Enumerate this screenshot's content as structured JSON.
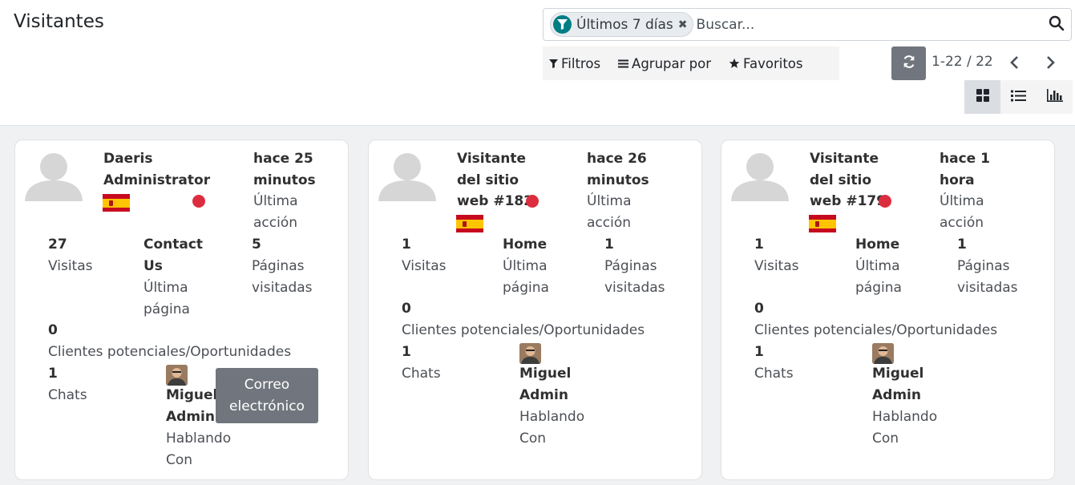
{
  "header": {
    "title": "Visitantes",
    "search": {
      "facet_label": "Últimos 7 días",
      "placeholder": "Buscar..."
    },
    "filters_label": "Filtros",
    "group_by_label": "Agrupar por",
    "favorites_label": "Favoritos",
    "pager": "1-22 / 22"
  },
  "cards": [
    {
      "name_line1": "Daeris",
      "name_line2": "Administrator",
      "last_action_time": "hace 25 minutos",
      "time_line1": "hace 25",
      "time_line2": "minutos",
      "last_action_label_1": "Última",
      "last_action_label_2": "acción",
      "visits_count": "27",
      "visits_label": "Visitas",
      "last_page_line1": "Contact",
      "last_page_line2": "Us",
      "last_page_label_1": "Última",
      "last_page_label_2": "página",
      "pages_count": "5",
      "pages_label_1": "Páginas",
      "pages_label_2": "visitadas",
      "leads_count": "0",
      "leads_label": "Clientes potenciales/Oportunidades",
      "chats_count": "1",
      "chats_label": "Chats",
      "operator_line1": "Miguel",
      "operator_line2": "Admin",
      "speaking_line1": "Hablando",
      "speaking_line2": "Con",
      "email_line1": "Correo",
      "email_line2": "electrónico"
    },
    {
      "name_line1": "Visitante",
      "name_line2": "del sitio",
      "name_line3": "web #182",
      "time_line1": "hace 26",
      "time_line2": "minutos",
      "last_action_label_1": "Última",
      "last_action_label_2": "acción",
      "visits_count": "1",
      "visits_label": "Visitas",
      "last_page": "Home",
      "last_page_label_1": "Última",
      "last_page_label_2": "página",
      "pages_count": "1",
      "pages_label_1": "Páginas",
      "pages_label_2": "visitadas",
      "leads_count": "0",
      "leads_label": "Clientes potenciales/Oportunidades",
      "chats_count": "1",
      "chats_label": "Chats",
      "operator_line1": "Miguel",
      "operator_line2": "Admin",
      "speaking_line1": "Hablando",
      "speaking_line2": "Con"
    },
    {
      "name_line1": "Visitante",
      "name_line2": "del sitio",
      "name_line3": "web #179",
      "time_line1": "hace 1",
      "time_line2": "hora",
      "last_action_label_1": "Última",
      "last_action_label_2": "acción",
      "visits_count": "1",
      "visits_label": "Visitas",
      "last_page": "Home",
      "last_page_label_1": "Última",
      "last_page_label_2": "página",
      "pages_count": "1",
      "pages_label_1": "Páginas",
      "pages_label_2": "visitadas",
      "leads_count": "0",
      "leads_label": "Clientes potenciales/Oportunidades",
      "chats_count": "1",
      "chats_label": "Chats",
      "operator_line1": "Miguel",
      "operator_line2": "Admin",
      "speaking_line1": "Hablando",
      "speaking_line2": "Con"
    }
  ],
  "colors": {
    "accent": "#017e84",
    "status_dot": "#dc2d3e",
    "button_gray": "#71757d",
    "kanban_bg": "#f0f1f3"
  },
  "icons": [
    "filter-icon",
    "close-icon",
    "search-icon",
    "funnel-icon",
    "list-icon",
    "star-icon",
    "reload-icon",
    "chevron-left-icon",
    "chevron-right-icon",
    "kanban-view-icon",
    "list-view-icon",
    "graph-view-icon",
    "avatar-placeholder-icon",
    "spain-flag-icon"
  ]
}
